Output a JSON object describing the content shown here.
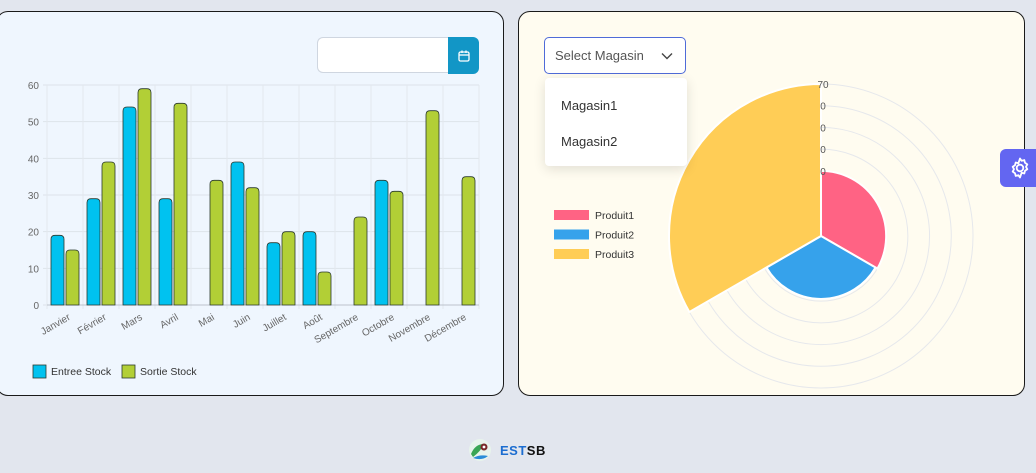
{
  "left_card": {
    "date_input": {
      "value": ""
    },
    "calendar_icon": "calendar-icon"
  },
  "right_card": {
    "select": {
      "placeholder": "Select Magasin",
      "options": [
        "Magasin1",
        "Magasin2"
      ]
    },
    "chevron_icon": "chevron-down-icon"
  },
  "settings_icon": "gear-icon",
  "footer": {
    "brand_part1": "EST",
    "brand_part2": "SB",
    "logo_icon": "leaf-gear-logo"
  },
  "chart_data": [
    {
      "type": "bar",
      "title": "",
      "xlabel": "",
      "ylabel": "",
      "ylim": [
        0,
        60
      ],
      "yticks": [
        0,
        10,
        20,
        30,
        40,
        50,
        60
      ],
      "grid": true,
      "legend_position": "bottom-left",
      "categories": [
        "Janvier",
        "Février",
        "Mars",
        "Avril",
        "Mai",
        "Juin",
        "Juillet",
        "Août",
        "Septembre",
        "Octobre",
        "Novembre",
        "Décembre"
      ],
      "series": [
        {
          "name": "Entree Stock",
          "color": "#00c2f0",
          "values": [
            19,
            29,
            54,
            29,
            0,
            39,
            17,
            20,
            0,
            34,
            0,
            0
          ]
        },
        {
          "name": "Sortie Stock",
          "color": "#b2cf36",
          "values": [
            15,
            39,
            59,
            55,
            34,
            32,
            20,
            9,
            24,
            31,
            53,
            35
          ]
        }
      ]
    },
    {
      "type": "polarArea",
      "title": "",
      "rmax": 70,
      "rticks_visible": [
        "70",
        "0",
        "0",
        "0",
        "0"
      ],
      "legend_position": "left",
      "categories": [
        "Produit1",
        "Produit2",
        "Produit3"
      ],
      "colors": [
        "#ff6384",
        "#36a2eb",
        "#ffcd56"
      ],
      "values": [
        30,
        29,
        70
      ]
    }
  ]
}
